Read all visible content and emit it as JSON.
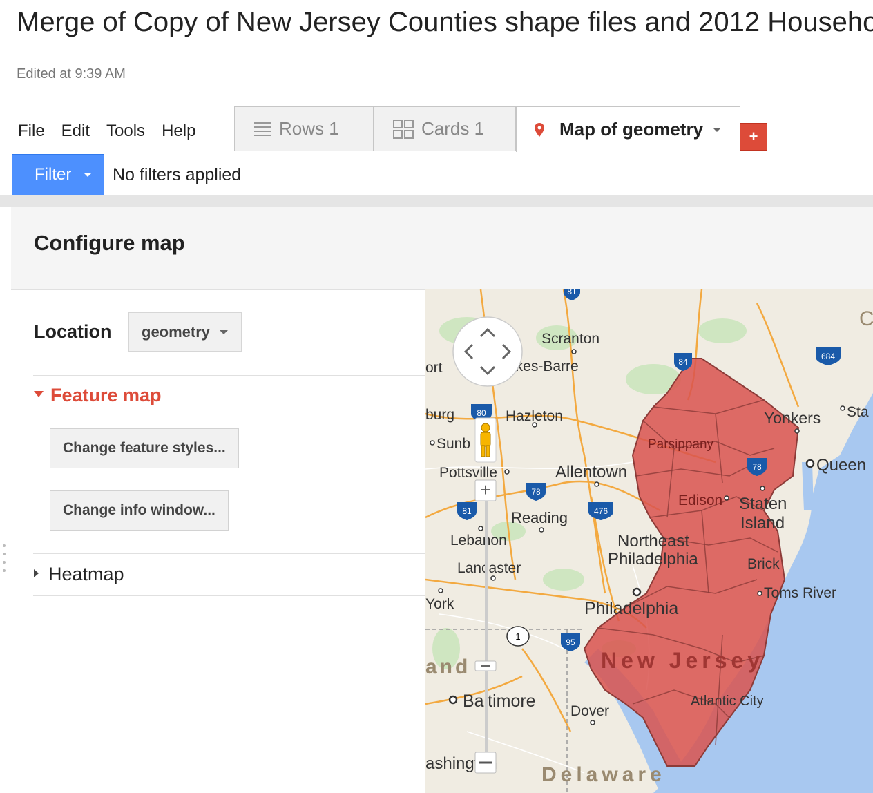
{
  "document": {
    "title": "Merge of Copy of New Jersey Counties shape files and 2012 Househo",
    "edited": "Edited at 9:39 AM"
  },
  "menu": [
    "File",
    "Edit",
    "Tools",
    "Help"
  ],
  "tabs": {
    "rows": "Rows 1",
    "cards": "Cards 1",
    "map": "Map of geometry",
    "add": "+"
  },
  "filter": {
    "button": "Filter",
    "status": "No filters applied"
  },
  "configure": {
    "title": "Configure map",
    "location_label": "Location",
    "location_value": "geometry",
    "feature_map": "Feature map",
    "change_styles": "Change feature styles...",
    "change_info": "Change info window...",
    "heatmap": "Heatmap"
  },
  "map": {
    "county_fill": "#d9534f",
    "water": "#a8c8f0",
    "land": "#f0ece2",
    "cities": [
      "Scranton",
      "lkes-Barre",
      "ort",
      "burg",
      "Hazleton",
      "Sunb",
      "Pottsville",
      "Allentown",
      "Reading",
      "Lebanon",
      "Lancaster",
      "York",
      "Northeast",
      "Philadelphia",
      "Philadelphia",
      "Parsippany",
      "Edison",
      "Staten",
      "Island",
      "Yonkers",
      "Sta",
      "Queen",
      "Brick",
      "Toms River",
      "New Jersey",
      "Atlantic City",
      "Dover",
      "Baltimore",
      "ashington",
      "and",
      "Delaware",
      "C"
    ],
    "shields": [
      "81",
      "84",
      "684",
      "80",
      "78",
      "78",
      "81",
      "476",
      "95",
      "1"
    ]
  }
}
